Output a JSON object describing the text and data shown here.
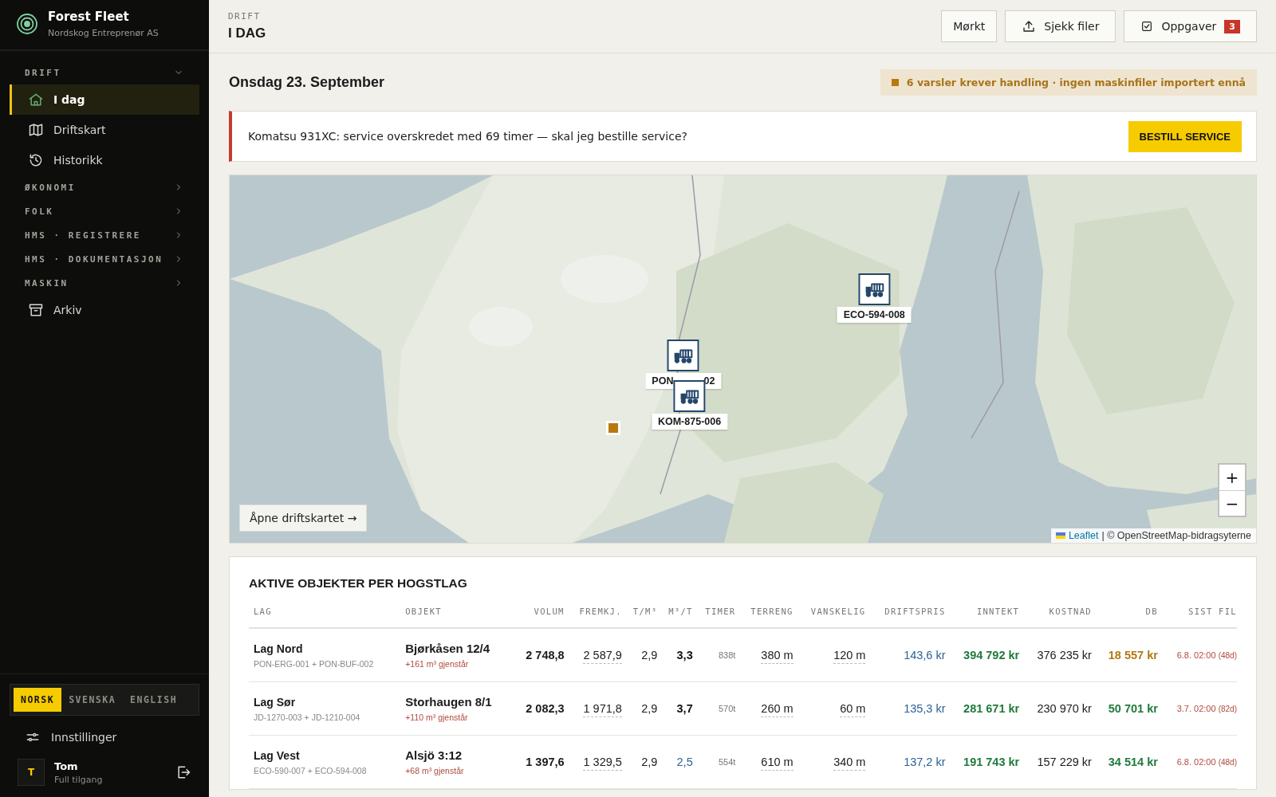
{
  "brand": {
    "title": "Forest Fleet",
    "subtitle": "Nordskog Entreprenør AS"
  },
  "sidebar": {
    "nav": [
      {
        "kind": "section",
        "label": "DRIFT",
        "expanded": true,
        "children": [
          {
            "label": "I dag",
            "selected": true
          },
          {
            "label": "Driftskart",
            "selected": false
          },
          {
            "label": "Historikk",
            "selected": false
          }
        ]
      },
      {
        "kind": "section",
        "label": "ØKONOMI",
        "expanded": false
      },
      {
        "kind": "section",
        "label": "FOLK",
        "expanded": false
      },
      {
        "kind": "section",
        "label": "HMS · REGISTRERE",
        "expanded": false
      },
      {
        "kind": "section",
        "label": "HMS · DOKUMENTASJON",
        "expanded": false
      },
      {
        "kind": "section",
        "label": "MASKIN",
        "expanded": false
      },
      {
        "kind": "link",
        "label": "Arkiv",
        "selected": false
      }
    ],
    "languages": [
      {
        "label": "NORSK",
        "selected": true
      },
      {
        "label": "SVENSKA",
        "selected": false
      },
      {
        "label": "ENGLISH",
        "selected": false
      }
    ],
    "settings": "Innstillinger",
    "user": {
      "initial": "T",
      "name": "Tom",
      "role": "Full tilgang"
    }
  },
  "header": {
    "eyebrow": "DRIFT",
    "title": "I DAG",
    "buttons": [
      {
        "label": "Mørkt"
      },
      {
        "label": "Sjekk filer"
      },
      {
        "label": "Oppgaver",
        "badge": "3"
      }
    ]
  },
  "date": "Onsdag 23. September",
  "notice": "6 varsler krever handling · ingen maskinfiler importert ennå",
  "alert": {
    "text": "Komatsu 931XC: service overskredet med 69 timer — skal jeg bestille service?",
    "button": "BESTILL SERVICE"
  },
  "map": {
    "markers": [
      {
        "label_parts": [
          "ECO-594-008"
        ]
      },
      {
        "label_parts": [
          "PON",
          "02"
        ]
      },
      {
        "label_parts": [
          "KOM-875-006"
        ]
      }
    ],
    "open_link": "Åpne driftskartet →",
    "zoom_in": "+",
    "zoom_out": "−",
    "attribution_link": "Leaflet",
    "attribution": "| © OpenStreetMap-bidragsyterne"
  },
  "table": {
    "title": "AKTIVE OBJEKTER PER HOGSTLAG",
    "columns": [
      "LAG",
      "OBJEKT",
      "VOLUM",
      "FREMKJ.",
      "T/M³",
      "M³/T",
      "TIMER",
      "TERRENG",
      "VANSKELIG",
      "DRIFTSPRIS",
      "INNTEKT",
      "KOSTNAD",
      "DB",
      "SIST FIL"
    ],
    "rows": [
      {
        "lag": "Lag Nord",
        "machines": "PON-ERG-001 + PON-BUF-002",
        "objekt": "Bjørkåsen 12/4",
        "remaining": "+161 m³ gjenstår",
        "volum": "2 748,8",
        "fremkj": "2 587,9",
        "tm3": "2,9",
        "m3t": {
          "text": "3,3",
          "color": "#111111",
          "bold": true
        },
        "timer": "838t",
        "terreng": "380 m",
        "vanskelig": "120 m",
        "driftspris": "143,6 kr",
        "inntekt": "394 792 kr",
        "kostnad": "376 235 kr",
        "db": {
          "text": "18 557 kr",
          "color": "#b07a12",
          "bold": true
        },
        "sist_fil": "6.8. 02:00",
        "sist_fil_age": "(48d)"
      },
      {
        "lag": "Lag Sør",
        "machines": "JD-1270-003 + JD-1210-004",
        "objekt": "Storhaugen 8/1",
        "remaining": "+110 m³ gjenstår",
        "volum": "2 082,3",
        "fremkj": "1 971,8",
        "tm3": "2,9",
        "m3t": {
          "text": "3,7",
          "color": "#111111",
          "bold": true
        },
        "timer": "570t",
        "terreng": "260 m",
        "vanskelig": "60 m",
        "driftspris": "135,3 kr",
        "inntekt": "281 671 kr",
        "kostnad": "230 970 kr",
        "db": {
          "text": "50 701 kr",
          "color": "#1f7a3a",
          "bold": true
        },
        "sist_fil": "3.7. 02:00",
        "sist_fil_age": "(82d)"
      },
      {
        "lag": "Lag Vest",
        "machines": "ECO-590-007 + ECO-594-008",
        "objekt": "Alsjö 3:12",
        "remaining": "+68 m³ gjenstår",
        "volum": "1 397,6",
        "fremkj": "1 329,5",
        "tm3": "2,9",
        "m3t": {
          "text": "2,5",
          "color": "#2b6296",
          "bold": false
        },
        "timer": "554t",
        "terreng": "610 m",
        "vanskelig": "340 m",
        "driftspris": "137,2 kr",
        "inntekt": "191 743 kr",
        "kostnad": "157 229 kr",
        "db": {
          "text": "34 514 kr",
          "color": "#1f7a3a",
          "bold": true
        },
        "sist_fil": "6.8. 02:00",
        "sist_fil_age": "(48d)"
      }
    ]
  }
}
